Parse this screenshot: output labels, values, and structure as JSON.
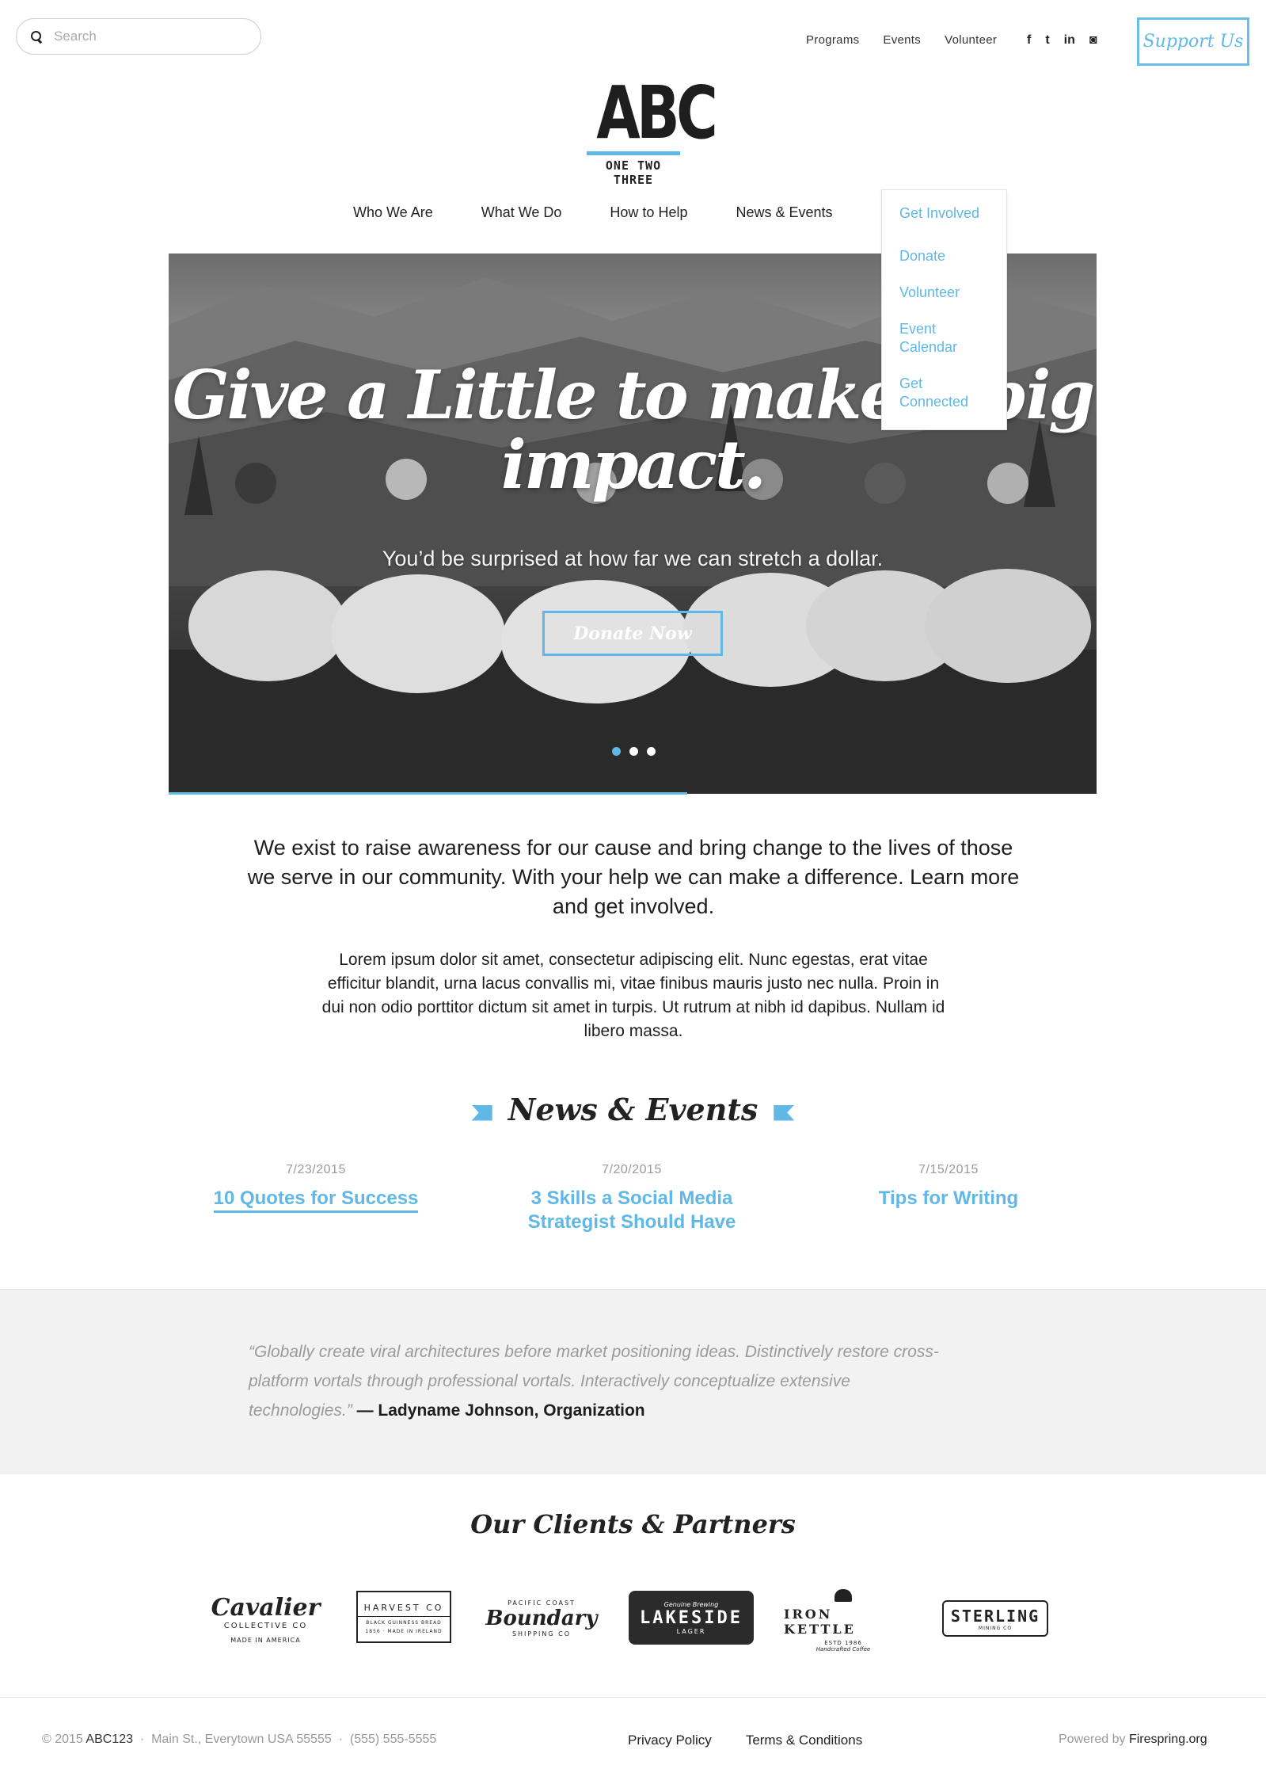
{
  "search": {
    "placeholder": "Search"
  },
  "utility_nav": [
    "Programs",
    "Events",
    "Volunteer"
  ],
  "social": [
    {
      "icon": "facebook-icon",
      "glyph": "f"
    },
    {
      "icon": "twitter-icon",
      "glyph": "t"
    },
    {
      "icon": "linkedin-icon",
      "glyph": "in"
    },
    {
      "icon": "instagram-icon",
      "glyph": "◙"
    }
  ],
  "support_button": "Support Us",
  "logo": {
    "mark": "ABC",
    "subtitle": "ONE TWO THREE"
  },
  "main_nav": [
    "Who We Are",
    "What We Do",
    "How to Help",
    "News & Events"
  ],
  "dropdown": {
    "label": "Get Involved",
    "items": [
      "Donate",
      "Volunteer",
      "Event Calendar",
      "Get Connected"
    ]
  },
  "hero": {
    "title": "Give a Little to make a big impact.",
    "subtitle": "You’d be surprised at how far we can stretch a dollar.",
    "button": "Donate Now",
    "slides": 3,
    "active_slide": 1
  },
  "intro": "We exist to raise awareness for our cause and bring change to the lives of those we serve in our community. With your help we can make a difference. Learn more and get involved.",
  "lorem": "Lorem ipsum dolor sit amet, consectetur adipiscing elit. Nunc egestas, erat vitae efficitur blandit, urna lacus convallis mi, vitae finibus mauris justo nec nulla. Proin in dui non odio porttitor dictum sit amet in turpis. Ut rutrum at nibh id dapibus. Nullam id libero massa.",
  "news_title": "News & Events",
  "news": [
    {
      "date": "7/23/2015",
      "title": "10 Quotes for Success"
    },
    {
      "date": "7/20/2015",
      "title": "3 Skills a Social Media Strategist Should Have"
    },
    {
      "date": "7/15/2015",
      "title": "Tips for Writing"
    }
  ],
  "quote": {
    "text": "“Globally create viral architectures before market positioning ideas. Distinctively restore cross-platform vortals through professional vortals. Interactively conceptualize extensive technologies.”",
    "attribution": "— Ladyname Johnson, Organization"
  },
  "partners_title": "Our Clients & Partners",
  "partners": [
    {
      "name": "Cavalier",
      "line1": "COLLECTIVE CO",
      "line2": "MADE IN AMERICA"
    },
    {
      "name": "HARVEST CO",
      "line1": "BLACK GUINNESS BREAD",
      "line2": "1856 · MADE IN IRELAND"
    },
    {
      "name": "Boundary",
      "line1": "PACIFIC COAST",
      "line2": "SHIPPING CO"
    },
    {
      "name": "LAKESIDE",
      "line1": "Genuine Brewing",
      "line2": "LAGER"
    },
    {
      "name": "IRON KETTLE",
      "line1": "ESTD 1986",
      "line2": "Handcrafted Coffee"
    },
    {
      "name": "STERLING",
      "line1": "MINING CO",
      "line2": ""
    }
  ],
  "footer": {
    "copyright": "© 2015",
    "org": "ABC123",
    "address": "Main St., Everytown USA 55555",
    "phone": "(555) 555-5555",
    "links": [
      "Privacy Policy",
      "Terms & Conditions"
    ],
    "powered_prefix": "Powered by",
    "powered_brand": "Firespring.org"
  },
  "colors": {
    "accent": "#5fb8e6",
    "text": "#1e1e1e",
    "muted": "#999999",
    "band": "#f2f2f2"
  }
}
